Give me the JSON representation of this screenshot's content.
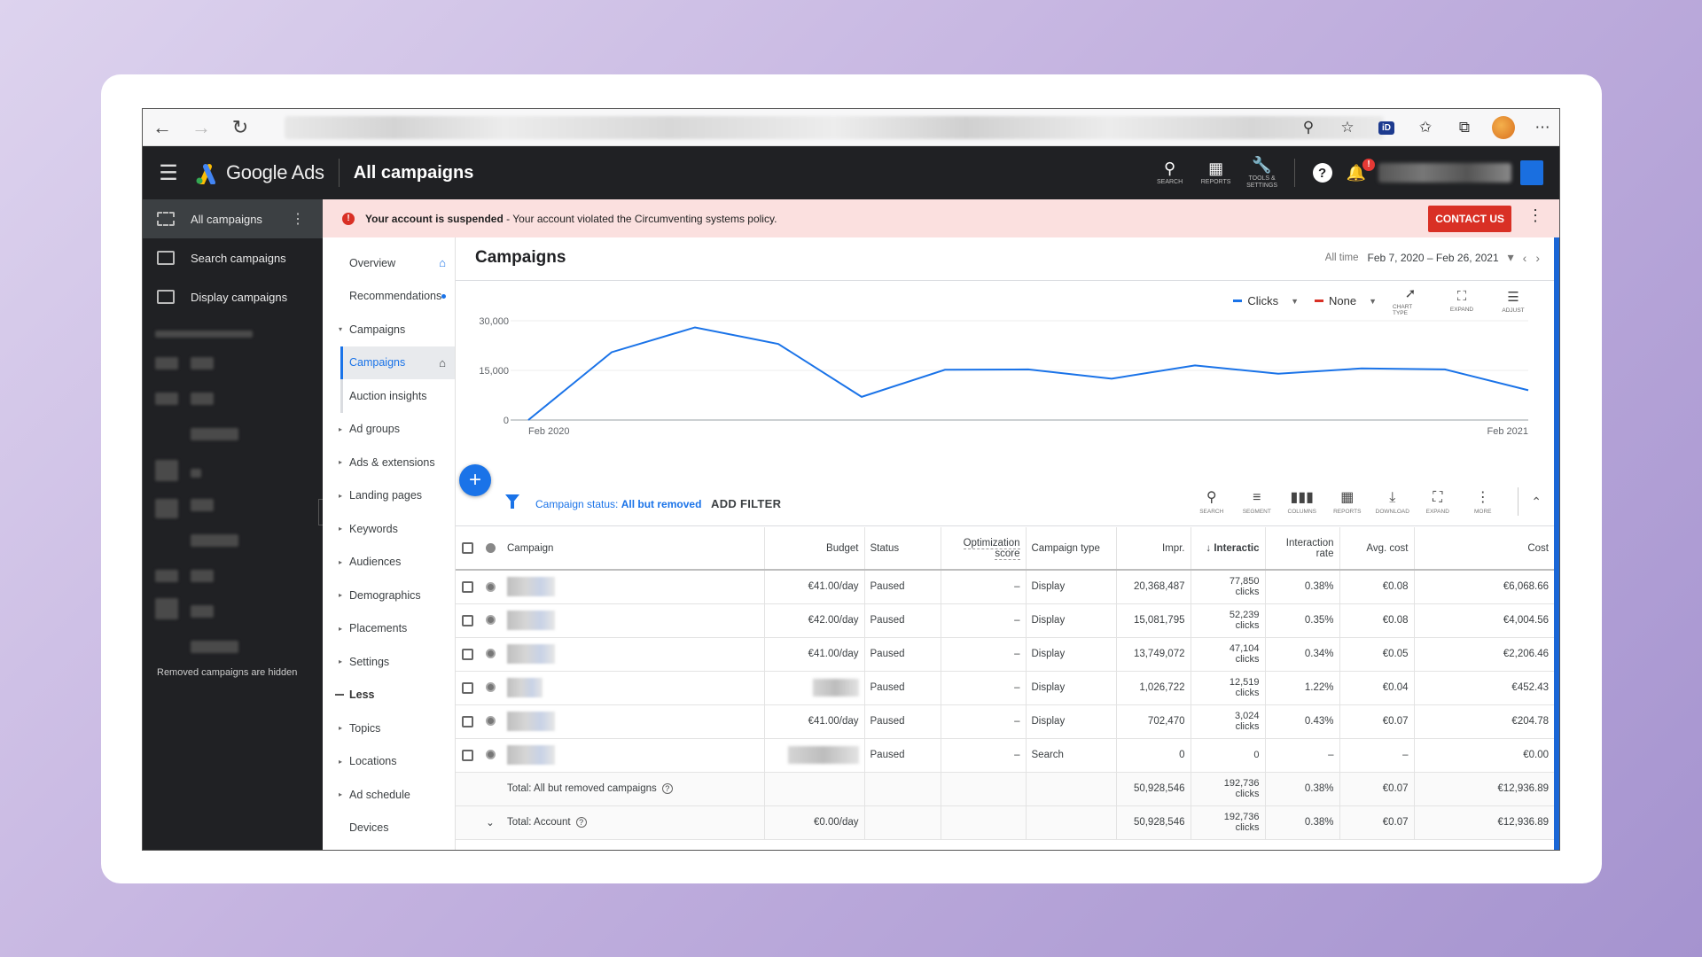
{
  "browser": {
    "icons": [
      "back-arrow-icon",
      "forward-arrow-icon",
      "reload-icon",
      "zoom-icon",
      "favorite-add-icon",
      "id-extension-icon",
      "favorites-icon",
      "collections-icon",
      "profile-avatar",
      "more-icon"
    ],
    "id_badge": "iD"
  },
  "header": {
    "app_name": "Google Ads",
    "page_title": "All campaigns",
    "tools": [
      {
        "label": "SEARCH",
        "icon": "search-icon"
      },
      {
        "label": "REPORTS",
        "icon": "reports-icon"
      },
      {
        "label": "TOOLS & SETTINGS",
        "icon": "wrench-icon"
      }
    ],
    "help": "?",
    "notif_badge": "!"
  },
  "sidebar": {
    "items": [
      {
        "label": "All campaigns"
      },
      {
        "label": "Search campaigns"
      },
      {
        "label": "Display campaigns"
      }
    ],
    "removed_note": "Removed campaigns are hidden"
  },
  "banner": {
    "bold": "Your account is suspended",
    "text": " - Your account violated the Circumventing systems policy.",
    "button": "CONTACT US"
  },
  "nav": {
    "items": [
      {
        "label": "Overview"
      },
      {
        "label": "Recommendations"
      },
      {
        "label": "Campaigns"
      },
      {
        "label": "Campaigns"
      },
      {
        "label": "Auction insights"
      },
      {
        "label": "Ad groups"
      },
      {
        "label": "Ads & extensions"
      },
      {
        "label": "Landing pages"
      },
      {
        "label": "Keywords"
      },
      {
        "label": "Audiences"
      },
      {
        "label": "Demographics"
      },
      {
        "label": "Placements"
      },
      {
        "label": "Settings"
      },
      {
        "label": "Less"
      },
      {
        "label": "Topics"
      },
      {
        "label": "Locations"
      },
      {
        "label": "Ad schedule"
      },
      {
        "label": "Devices"
      }
    ]
  },
  "main": {
    "title": "Campaigns",
    "date_label": "All time",
    "date_range": "Feb 7, 2020 – Feb 26, 2021",
    "metric1": "Clicks",
    "metric2": "None",
    "chart_tools": [
      "CHART TYPE",
      "EXPAND",
      "ADJUST"
    ],
    "filter_prefix": "Campaign status: ",
    "filter_value": "All but removed",
    "add_filter": "ADD FILTER",
    "table_tools": [
      "SEARCH",
      "SEGMENT",
      "COLUMNS",
      "REPORTS",
      "DOWNLOAD",
      "EXPAND",
      "MORE"
    ]
  },
  "colors": {
    "accent": "#1a73e8",
    "clicks_series": "#1a73e8",
    "none_series": "#d93025",
    "banner_bg": "#fbe0df",
    "header_bg": "#202124"
  },
  "chart_data": {
    "type": "line",
    "title": "",
    "xlabel": "",
    "ylabel": "",
    "x_tick_labels": [
      "Feb 2020",
      "Feb 2021"
    ],
    "y_ticks": [
      "30,000",
      "15,000",
      "0"
    ],
    "ylim": [
      0,
      30000
    ],
    "grid": true,
    "series": [
      {
        "name": "Clicks",
        "values": [
          0,
          20500,
          28000,
          23000,
          7000,
          15200,
          15300,
          12500,
          16500,
          14000,
          15600,
          15300,
          9000
        ]
      }
    ]
  },
  "table": {
    "headers": [
      "Campaign",
      "Budget",
      "Status",
      "Optimization score",
      "Campaign type",
      "Impr.",
      "Interactic",
      "Interaction rate",
      "Avg. cost",
      "Cost"
    ],
    "rows": [
      {
        "budget": "€41.00/day",
        "status": "Paused",
        "opt": "–",
        "type": "Display",
        "impr": "20,368,487",
        "inter1": "77,850",
        "inter2": "clicks",
        "rate": "0.38%",
        "avg": "€0.08",
        "cost": "€6,068.66"
      },
      {
        "budget": "€42.00/day",
        "status": "Paused",
        "opt": "–",
        "type": "Display",
        "impr": "15,081,795",
        "inter1": "52,239",
        "inter2": "clicks",
        "rate": "0.35%",
        "avg": "€0.08",
        "cost": "€4,004.56"
      },
      {
        "budget": "€41.00/day",
        "status": "Paused",
        "opt": "–",
        "type": "Display",
        "impr": "13,749,072",
        "inter1": "47,104",
        "inter2": "clicks",
        "rate": "0.34%",
        "avg": "€0.05",
        "cost": "€2,206.46"
      },
      {
        "budget": "",
        "status": "Paused",
        "opt": "–",
        "type": "Display",
        "impr": "1,026,722",
        "inter1": "12,519",
        "inter2": "clicks",
        "rate": "1.22%",
        "avg": "€0.04",
        "cost": "€452.43"
      },
      {
        "budget": "€41.00/day",
        "status": "Paused",
        "opt": "–",
        "type": "Display",
        "impr": "702,470",
        "inter1": "3,024",
        "inter2": "clicks",
        "rate": "0.43%",
        "avg": "€0.07",
        "cost": "€204.78"
      },
      {
        "budget": "",
        "status": "Paused",
        "opt": "–",
        "type": "Search",
        "impr": "0",
        "inter1": "0",
        "inter2": "",
        "rate": "–",
        "avg": "–",
        "cost": "€0.00"
      }
    ],
    "total1": {
      "label": "Total: All but removed campaigns",
      "impr": "50,928,546",
      "inter1": "192,736",
      "inter2": "clicks",
      "rate": "0.38%",
      "avg": "€0.07",
      "cost": "€12,936.89"
    },
    "total2": {
      "label": "Total: Account",
      "budget": "€0.00/day",
      "impr": "50,928,546",
      "inter1": "192,736",
      "inter2": "clicks",
      "rate": "0.38%",
      "avg": "€0.07",
      "cost": "€12,936.89"
    }
  }
}
